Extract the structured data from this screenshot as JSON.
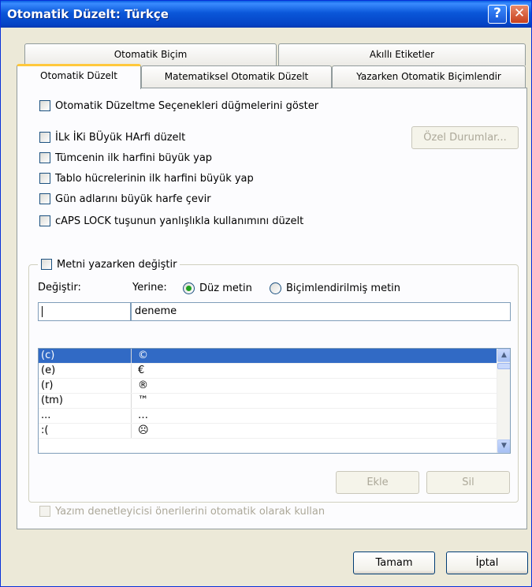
{
  "window": {
    "title": "Otomatik Düzelt: Türkçe"
  },
  "titlebar": {
    "help_glyph": "?",
    "close_glyph": "✕"
  },
  "tabs": {
    "row1": [
      "Otomatik Biçim",
      "Akıllı Etiketler"
    ],
    "row2": [
      "Otomatik Düzelt",
      "Matematiksel Otomatik Düzelt",
      "Yazarken Otomatik Biçimlendir"
    ],
    "active": "Otomatik Düzelt"
  },
  "options": {
    "show_buttons": "Otomatik Düzeltme Seçenekleri düğmelerini göster",
    "two_initials": "İLk İKi BÜyük HArfi düzelt",
    "first_letter_sentence": "Tümcenin ilk harfini büyük yap",
    "first_letter_table": "Tablo hücrelerinin ilk harfini büyük yap",
    "day_names": "Gün adlarını büyük harfe çevir",
    "caps_lock": "cAPS LOCK tuşunun yanlışlıkla kullanımını düzelt"
  },
  "exceptions_button": "Özel Durumlar...",
  "replace_group": {
    "legend": "Metni yazarken değiştir",
    "replace_label": "Değiştir:",
    "with_label": "Yerine:",
    "plain_text": "Düz metin",
    "formatted_text": "Biçimlendirilmiş metin",
    "replace_value": "",
    "with_value": "deneme",
    "entries": [
      {
        "from": "(c)",
        "to": "©"
      },
      {
        "from": "(e)",
        "to": "€"
      },
      {
        "from": "(r)",
        "to": "®"
      },
      {
        "from": "(tm)",
        "to": "™"
      },
      {
        "from": "...",
        "to": "…"
      },
      {
        "from": ":(",
        "to": "☹"
      }
    ],
    "add_button": "Ekle",
    "delete_button": "Sil",
    "spell_suggestions": "Yazım denetleyicisi önerilerini otomatik olarak kullan"
  },
  "footer": {
    "ok": "Tamam",
    "cancel": "İptal"
  },
  "colors": {
    "titlebar": "#0a57d9",
    "selection": "#316ac5",
    "tab_accent": "#ffc83c"
  },
  "icons": {
    "scroll_up": "scroll-up-arrow-icon",
    "scroll_down": "scroll-down-arrow-icon"
  }
}
